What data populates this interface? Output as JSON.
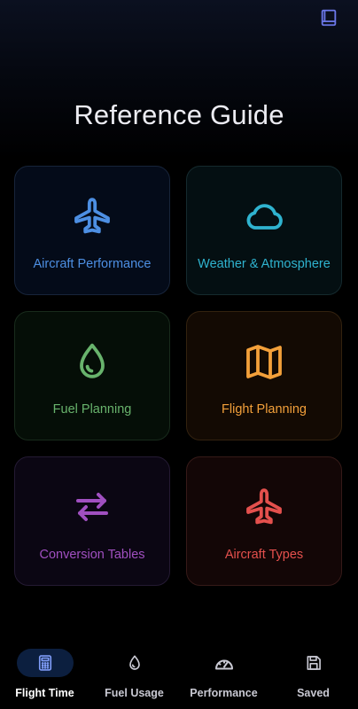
{
  "header": {
    "book_icon": "book-icon"
  },
  "page": {
    "title": "Reference Guide"
  },
  "cards": [
    {
      "label": "Aircraft Performance",
      "icon": "airplane-icon",
      "color": "#4d8fe3"
    },
    {
      "label": "Weather & Atmosphere",
      "icon": "cloud-icon",
      "color": "#2fb3cf"
    },
    {
      "label": "Fuel Planning",
      "icon": "droplet-icon",
      "color": "#68b36c"
    },
    {
      "label": "Flight Planning",
      "icon": "map-icon",
      "color": "#f3a03a"
    },
    {
      "label": "Conversion Tables",
      "icon": "swap-arrows-icon",
      "color": "#a04fc0"
    },
    {
      "label": "Aircraft Types",
      "icon": "airplane-icon",
      "color": "#e4504d"
    }
  ],
  "bottom_nav": {
    "items": [
      {
        "label": "Flight Time",
        "icon": "calculator-icon",
        "active": true
      },
      {
        "label": "Fuel Usage",
        "icon": "droplet-icon",
        "active": false
      },
      {
        "label": "Performance",
        "icon": "gauge-icon",
        "active": false
      },
      {
        "label": "Saved",
        "icon": "save-icon",
        "active": false
      }
    ]
  },
  "colors": {
    "accent": "#5a78ff",
    "background": "#000000",
    "active_pill": "#0c1f3f"
  }
}
